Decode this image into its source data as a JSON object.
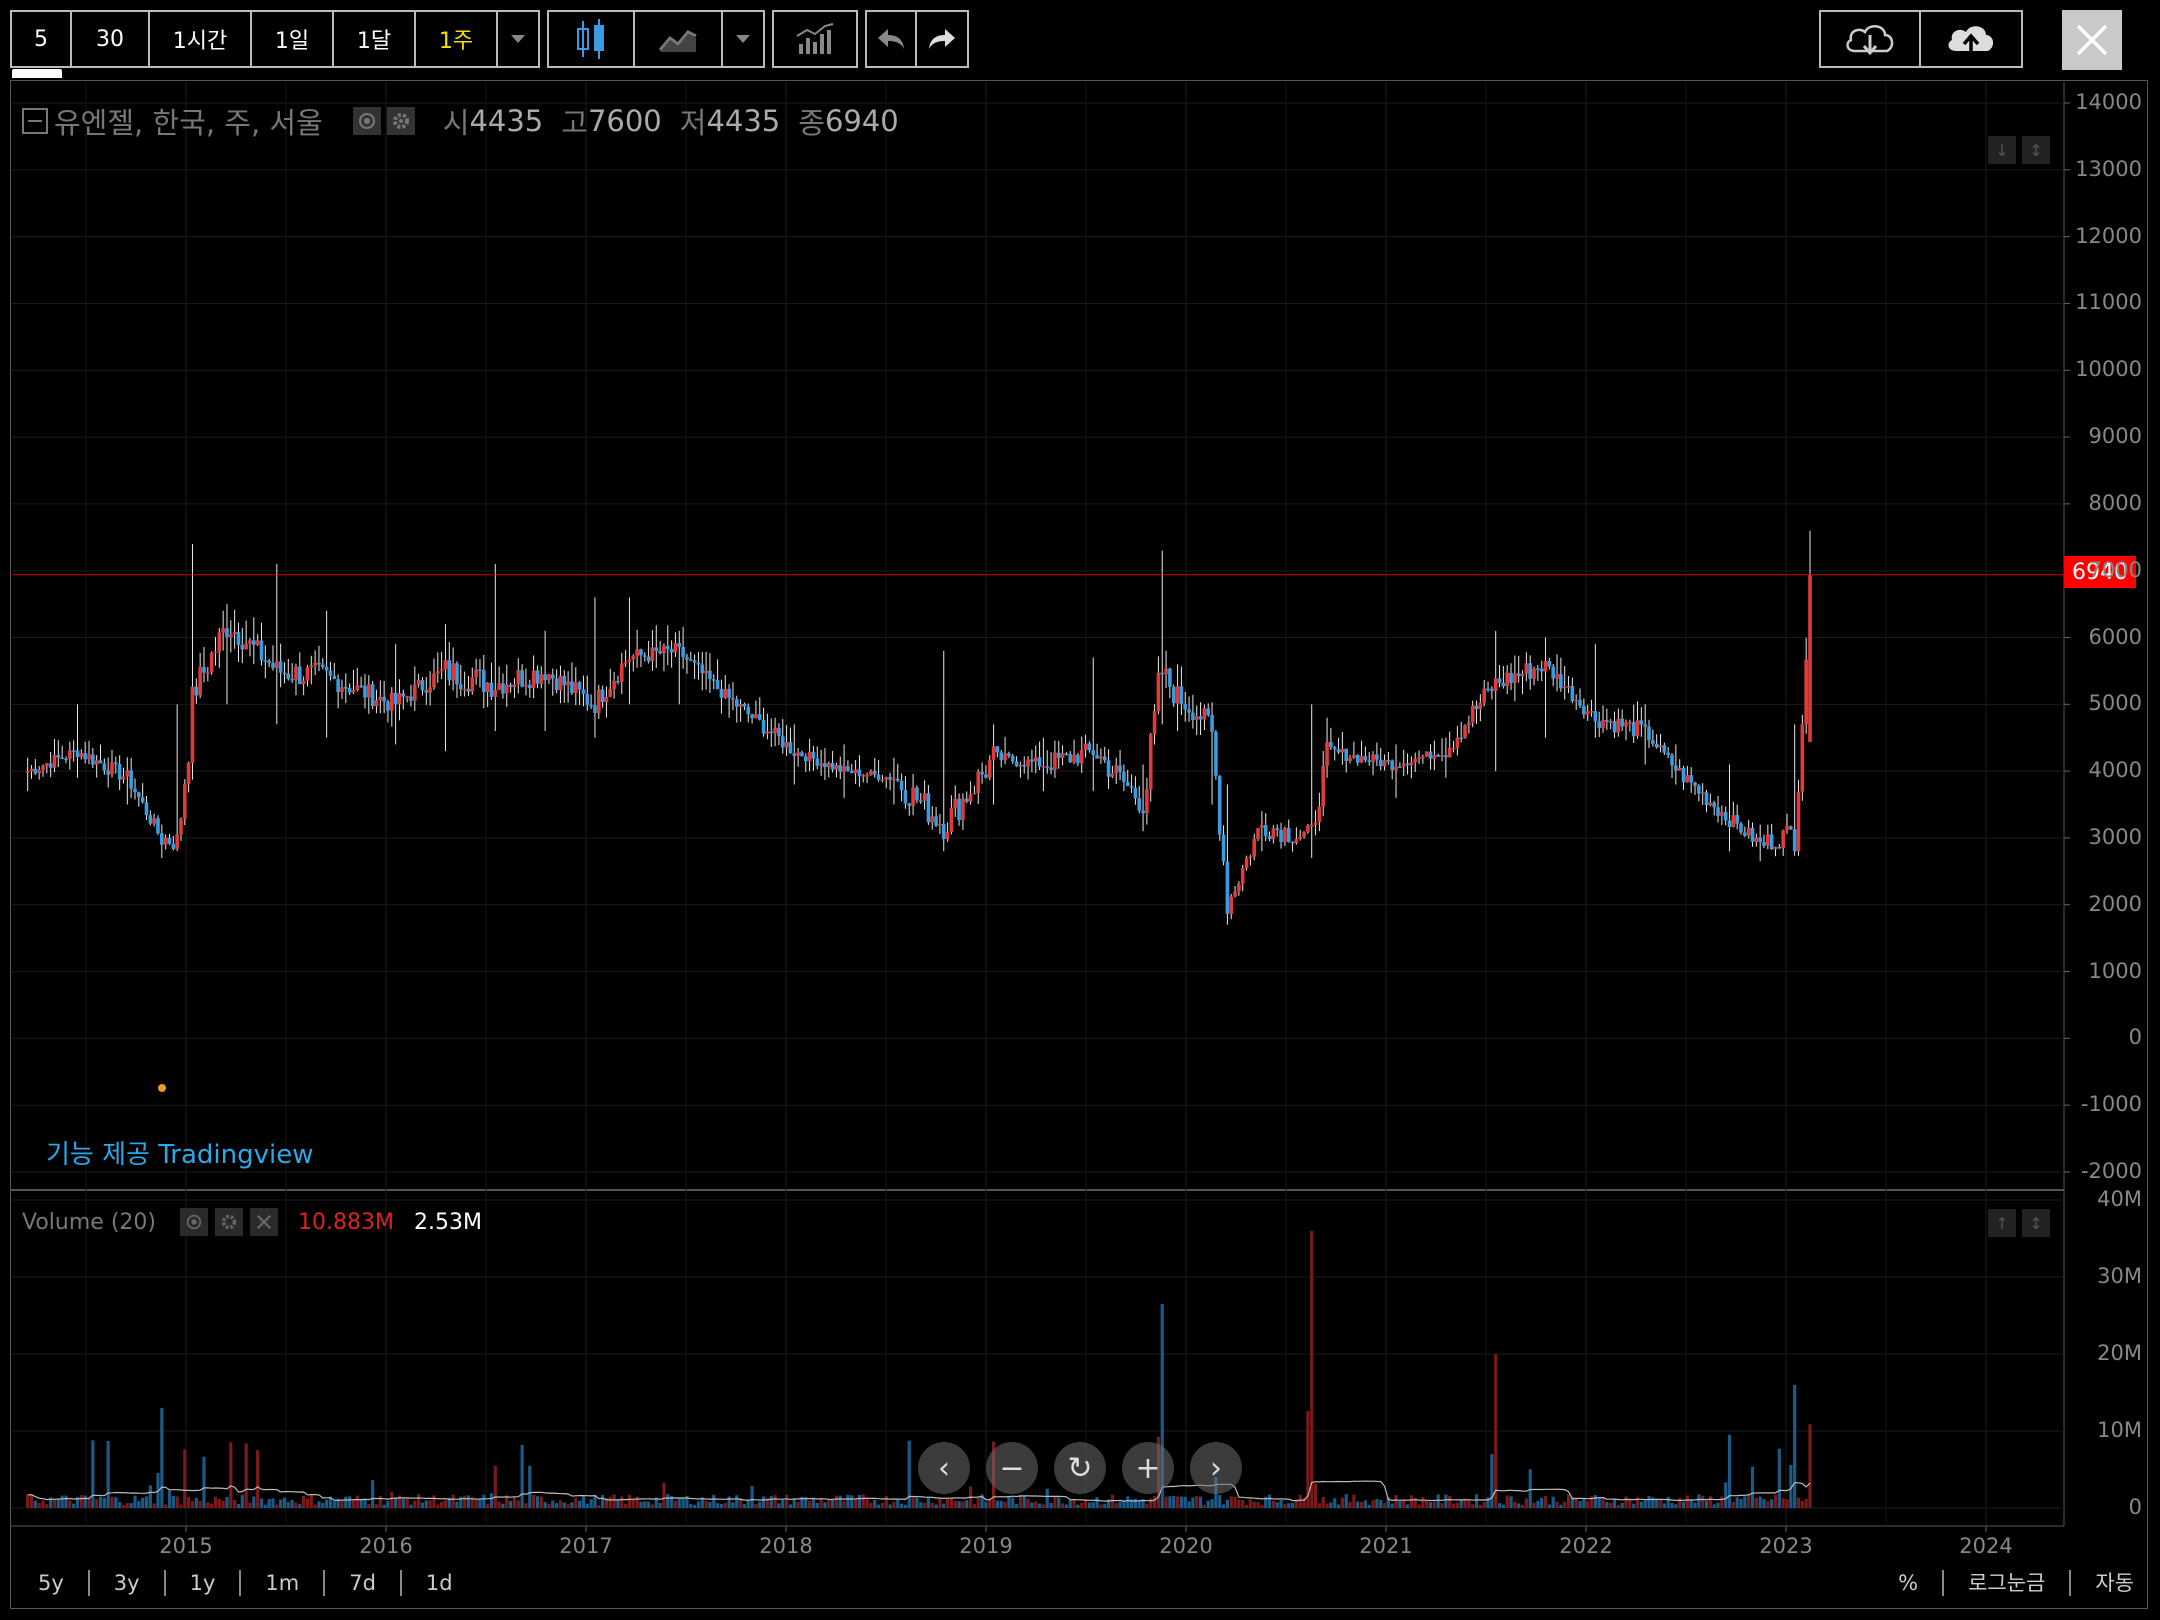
{
  "toolbar": {
    "intervals": [
      "5",
      "30",
      "1시간",
      "1일",
      "1달",
      "1주"
    ],
    "active_interval": "1주"
  },
  "legend": {
    "symbol": "유엔젤, 한국, 주, 서울",
    "open_label": "시",
    "open": "4435",
    "high_label": "고",
    "high": "7600",
    "low_label": "저",
    "low": "4435",
    "close_label": "종",
    "close": "6940"
  },
  "volume_legend": {
    "label": "Volume (20)",
    "value": "10.883M",
    "ma_value": "2.53M"
  },
  "credit": "기능 제공 Tradingview",
  "price_tag": "6940",
  "price_axis": [
    "14000",
    "13000",
    "12000",
    "11000",
    "10000",
    "9000",
    "8000",
    "7000",
    "6000",
    "5000",
    "4000",
    "3000",
    "2000",
    "1000",
    "0",
    "-1000",
    "-2000"
  ],
  "volume_axis": [
    "40M",
    "30M",
    "20M",
    "10M",
    "0"
  ],
  "time_axis": [
    "2015",
    "2016",
    "2017",
    "2018",
    "2019",
    "2020",
    "2021",
    "2022",
    "2023",
    "2024"
  ],
  "range_buttons": [
    "5y",
    "3y",
    "1y",
    "1m",
    "7d",
    "1d"
  ],
  "scale_buttons": [
    "%",
    "로그눈금",
    "자동"
  ],
  "colors": {
    "up": "#e03a3a",
    "down": "#3a9be0",
    "price_line": "#ff0000",
    "accent": "#f5e000"
  },
  "chart_data": {
    "type": "candlestick",
    "interval": "weekly",
    "x": [
      "2014-03",
      "2014-06",
      "2014-09",
      "2014-11",
      "2014-12",
      "2015-01",
      "2015-03",
      "2015-06",
      "2015-09",
      "2016-01",
      "2016-04",
      "2016-07",
      "2016-10",
      "2017-01",
      "2017-03",
      "2017-06",
      "2017-09",
      "2018-01",
      "2018-04",
      "2018-07",
      "2018-10",
      "2019-01",
      "2019-04",
      "2019-07",
      "2019-10",
      "2019-11",
      "2019-12",
      "2020-02",
      "2020-03",
      "2020-05",
      "2020-08",
      "2020-09",
      "2021-01",
      "2021-04",
      "2021-07",
      "2021-10",
      "2022-01",
      "2022-04",
      "2022-06",
      "2022-09",
      "2022-11",
      "2023-01",
      "2023-02"
    ],
    "close": [
      4000,
      4300,
      3900,
      3000,
      2950,
      5200,
      6200,
      5500,
      5400,
      5000,
      5500,
      5300,
      5500,
      5000,
      5700,
      5800,
      5100,
      4300,
      4000,
      3900,
      3200,
      4200,
      4100,
      4300,
      3500,
      5500,
      5100,
      4700,
      2000,
      3200,
      3000,
      4300,
      4100,
      4300,
      5300,
      5600,
      4800,
      4600,
      4000,
      3300,
      2900,
      3100,
      6940
    ],
    "high": [
      4200,
      5000,
      4100,
      3200,
      5000,
      7400,
      6500,
      7100,
      6400,
      5900,
      6200,
      7100,
      6100,
      6600,
      6600,
      6100,
      5300,
      4700,
      4400,
      4200,
      5800,
      4700,
      4500,
      5700,
      4100,
      7300,
      5600,
      5000,
      3800,
      3400,
      5000,
      4800,
      4400,
      4500,
      6100,
      6000,
      5900,
      5000,
      4400,
      4100,
      3200,
      4700,
      7600
    ],
    "low": [
      3700,
      3900,
      3500,
      2700,
      2800,
      4400,
      5000,
      4700,
      4500,
      4400,
      4300,
      4600,
      4600,
      4500,
      5000,
      5000,
      4800,
      3800,
      3600,
      3500,
      2800,
      3500,
      3700,
      3700,
      3100,
      4700,
      4600,
      3500,
      1700,
      2800,
      2700,
      3900,
      3600,
      3900,
      4000,
      4500,
      4500,
      4100,
      3800,
      2800,
      2650,
      2800,
      4435
    ],
    "volume_ma_value": "2.53M",
    "last_volume": "10.883M",
    "volume_spikes": [
      {
        "x": "2014-11",
        "value": 13
      },
      {
        "x": "2016-07",
        "value": 5.5
      },
      {
        "x": "2019-11",
        "value": 26.5
      },
      {
        "x": "2020-08",
        "value": 36
      },
      {
        "x": "2021-07",
        "value": 20
      },
      {
        "x": "2022-09",
        "value": 9.5
      },
      {
        "x": "2023-01",
        "value": 16
      }
    ],
    "ylim": [
      -2000,
      14000
    ],
    "volume_ylim": [
      0,
      40
    ]
  }
}
